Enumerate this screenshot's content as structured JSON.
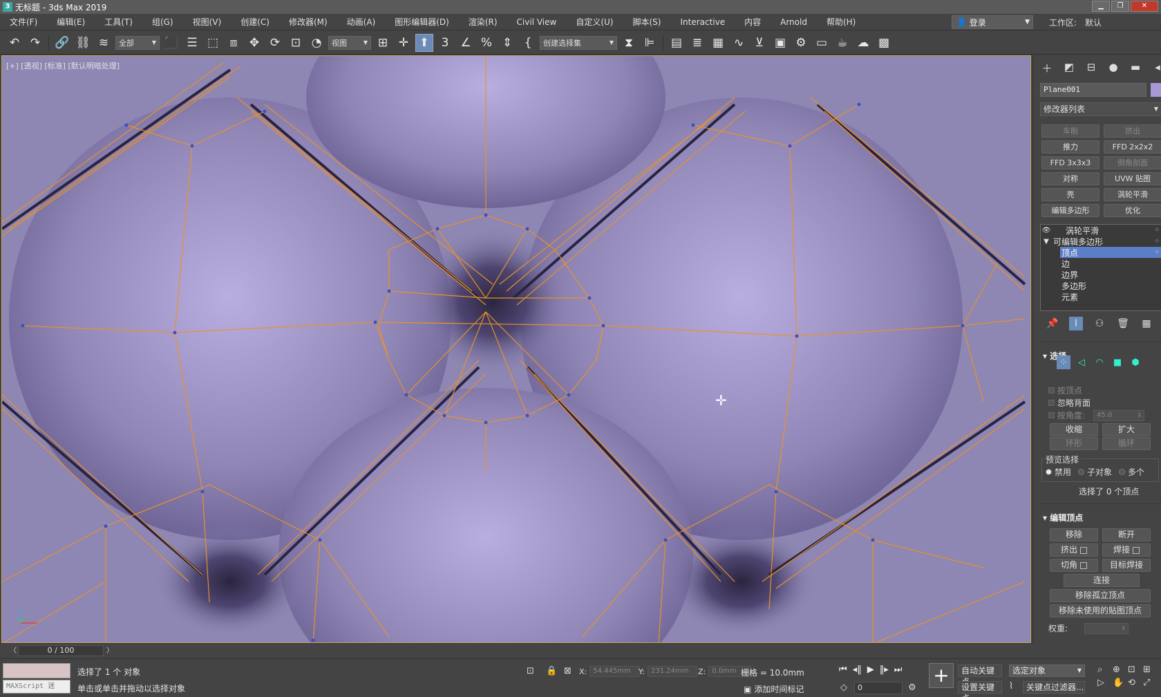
{
  "window": {
    "title": "无标题 - 3ds Max 2019",
    "app_icon_text": "3"
  },
  "menu": {
    "items": [
      "文件(F)",
      "编辑(E)",
      "工具(T)",
      "组(G)",
      "视图(V)",
      "创建(C)",
      "修改器(M)",
      "动画(A)",
      "图形编辑器(D)",
      "渲染(R)",
      "Civil View",
      "自定义(U)",
      "脚本(S)",
      "Interactive",
      "内容",
      "Arnold",
      "帮助(H)"
    ],
    "login": "登录",
    "workspace_label": "工作区:",
    "workspace_value": "默认"
  },
  "toolbar": {
    "selection_filter": "全部",
    "reference_coord": "视图",
    "named_selection": "创建选择集"
  },
  "viewport": {
    "label": "[+] [透视] [标准] [默认明暗处理]",
    "surface_color": "#8e86b3",
    "wire_color": "#e8922a"
  },
  "command_panel": {
    "object_name": "Plane001",
    "object_color": "#a898d6",
    "modifier_list": "修改器列表",
    "modifier_buttons": [
      {
        "label": "车削",
        "dim": true
      },
      {
        "label": "挤出",
        "dim": true
      },
      {
        "label": "推力",
        "dim": false
      },
      {
        "label": "FFD 2x2x2",
        "dim": false
      },
      {
        "label": "FFD 3x3x3",
        "dim": false
      },
      {
        "label": "倒角剖面",
        "dim": true
      },
      {
        "label": "对称",
        "dim": false
      },
      {
        "label": "UVW 贴图",
        "dim": false
      },
      {
        "label": "壳",
        "dim": false
      },
      {
        "label": "涡轮平滑",
        "dim": false
      },
      {
        "label": "编辑多边形",
        "dim": false
      },
      {
        "label": "优化",
        "dim": false
      }
    ],
    "stack": {
      "turbosmooth": "涡轮平滑",
      "editable_poly": "可编辑多边形",
      "sub_objects": [
        "顶点",
        "边",
        "边界",
        "多边形",
        "元素"
      ]
    },
    "selection": {
      "title": "选择",
      "by_vertex": "按顶点",
      "ignore_backfacing": "忽略背面",
      "by_angle": "按角度:",
      "angle_value": "45.0",
      "shrink": "收缩",
      "grow": "扩大",
      "ring": "环形",
      "loop": "循环",
      "preview_title": "预览选择",
      "preview_options": [
        "禁用",
        "子对象",
        "多个"
      ],
      "status": "选择了 0 个顶点"
    },
    "edit_vertices": {
      "title": "编辑顶点",
      "remove": "移除",
      "break": "断开",
      "extrude": "挤出",
      "weld": "焊接",
      "chamfer": "切角",
      "target_weld": "目标焊接",
      "connect": "连接",
      "remove_isolated": "移除孤立顶点",
      "remove_unused_map": "移除未使用的贴图顶点",
      "weight": "权重:"
    }
  },
  "timeline": {
    "frame": "0 / 100"
  },
  "status": {
    "maxscript": "MAXScript 迷",
    "selected": "选择了 1 个 对象",
    "prompt": "单击或单击并拖动以选择对象",
    "x_label": "X:",
    "x_value": "54.445mm",
    "y_label": "Y:",
    "y_value": "231.24mm",
    "z_label": "Z:",
    "z_value": "0.0mm",
    "grid": "栅格 = 10.0mm",
    "add_time_tag": "添加时间标记",
    "current_frame": "0",
    "auto_key": "自动关键点",
    "selected_object": "选定对象",
    "set_key": "设置关键点",
    "key_filters": "关键点过滤器..."
  }
}
